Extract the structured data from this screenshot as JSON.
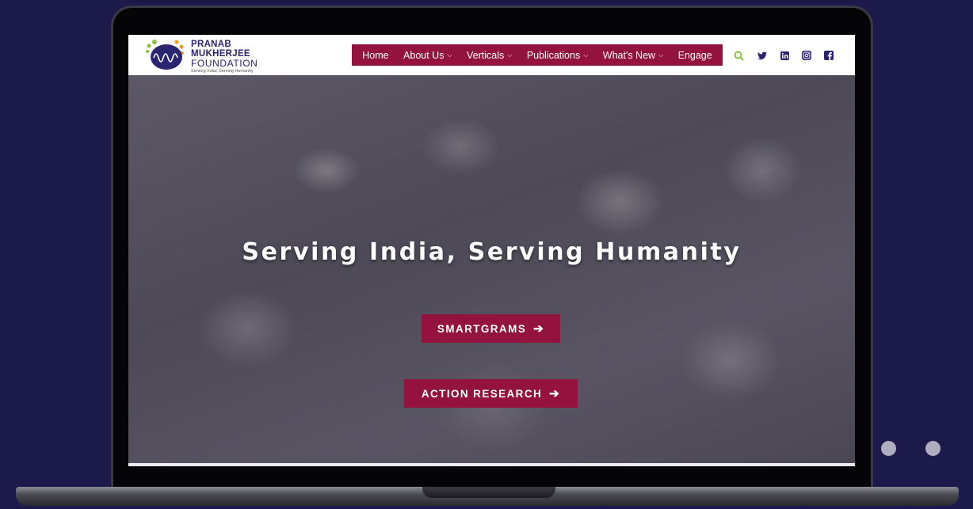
{
  "logo": {
    "line1": "PRANAB",
    "line2": "MUKHERJEE",
    "line3": "FOUNDATION",
    "tagline": "Serving India, Serving Humanity",
    "colors": {
      "primary": "#2b2470",
      "accent_green": "#8bbf3f",
      "accent_orange": "#f39a1e"
    }
  },
  "nav": {
    "items": [
      {
        "label": "Home",
        "has_caret": false
      },
      {
        "label": "About Us",
        "has_caret": true
      },
      {
        "label": "Verticals",
        "has_caret": true
      },
      {
        "label": "Publications",
        "has_caret": true
      },
      {
        "label": "What's New",
        "has_caret": true
      },
      {
        "label": "Engage",
        "has_caret": false
      }
    ],
    "caret_glyph": "⌵",
    "background_color": "#93123e",
    "icons": [
      "search-icon",
      "twitter-icon",
      "linkedin-icon",
      "instagram-icon",
      "facebook-icon"
    ]
  },
  "hero": {
    "title": "Serving India, Serving Humanity",
    "buttons": [
      {
        "label": "SMARTGRAMS",
        "arrow": "➔"
      },
      {
        "label": "ACTION RESEARCH",
        "arrow": "➔"
      }
    ],
    "button_color": "#93123e"
  },
  "frame": {
    "background_color": "#1c1a4b"
  }
}
